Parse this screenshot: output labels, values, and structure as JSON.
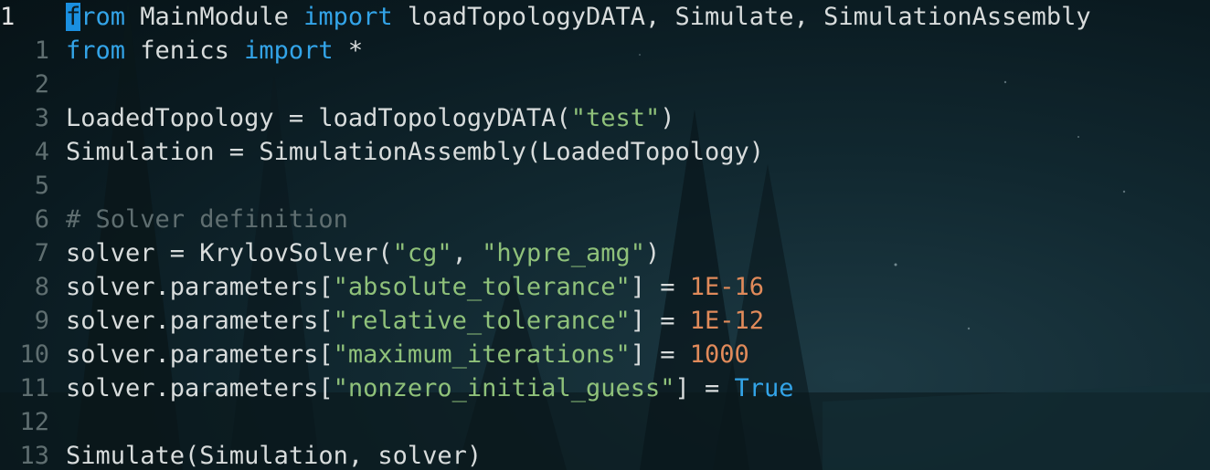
{
  "editor": {
    "lines": [
      {
        "number": "1",
        "tokens": [
          {
            "t": "f",
            "c": "kw cursor"
          },
          {
            "t": "rom",
            "c": "kw"
          },
          {
            "t": " MainModule ",
            "c": ""
          },
          {
            "t": "import",
            "c": "kw"
          },
          {
            "t": " loadTopologyDATA, Simulate, SimulationAssembly",
            "c": ""
          }
        ]
      },
      {
        "number": "1",
        "tokens": [
          {
            "t": "from",
            "c": "kw"
          },
          {
            "t": " fenics ",
            "c": ""
          },
          {
            "t": "import",
            "c": "kw"
          },
          {
            "t": " *",
            "c": ""
          }
        ]
      },
      {
        "number": "2",
        "tokens": []
      },
      {
        "number": "3",
        "tokens": [
          {
            "t": "LoadedTopology = loadTopologyDATA(",
            "c": ""
          },
          {
            "t": "\"test\"",
            "c": "str"
          },
          {
            "t": ")",
            "c": ""
          }
        ]
      },
      {
        "number": "4",
        "tokens": [
          {
            "t": "Simulation = SimulationAssembly(LoadedTopology)",
            "c": ""
          }
        ]
      },
      {
        "number": "5",
        "tokens": []
      },
      {
        "number": "6",
        "tokens": [
          {
            "t": "# Solver definition",
            "c": "cmt"
          }
        ]
      },
      {
        "number": "7",
        "tokens": [
          {
            "t": "solver = KrylovSolver(",
            "c": ""
          },
          {
            "t": "\"cg\"",
            "c": "str"
          },
          {
            "t": ", ",
            "c": ""
          },
          {
            "t": "\"hypre_amg\"",
            "c": "str"
          },
          {
            "t": ")",
            "c": ""
          }
        ]
      },
      {
        "number": "8",
        "tokens": [
          {
            "t": "solver.parameters[",
            "c": ""
          },
          {
            "t": "\"absolute_tolerance\"",
            "c": "str"
          },
          {
            "t": "] = ",
            "c": ""
          },
          {
            "t": "1E-16",
            "c": "num"
          }
        ]
      },
      {
        "number": "9",
        "tokens": [
          {
            "t": "solver.parameters[",
            "c": ""
          },
          {
            "t": "\"relative_tolerance\"",
            "c": "str"
          },
          {
            "t": "] = ",
            "c": ""
          },
          {
            "t": "1E-12",
            "c": "num"
          }
        ]
      },
      {
        "number": "10",
        "tokens": [
          {
            "t": "solver.parameters[",
            "c": ""
          },
          {
            "t": "\"maximum_iterations\"",
            "c": "str"
          },
          {
            "t": "] = ",
            "c": ""
          },
          {
            "t": "1000",
            "c": "num"
          }
        ]
      },
      {
        "number": "11",
        "tokens": [
          {
            "t": "solver.parameters[",
            "c": ""
          },
          {
            "t": "\"nonzero_initial_guess\"",
            "c": "str"
          },
          {
            "t": "] = ",
            "c": ""
          },
          {
            "t": "True",
            "c": "bool"
          }
        ]
      },
      {
        "number": "12",
        "tokens": []
      },
      {
        "number": "13",
        "tokens": [
          {
            "t": "Simulate(Simulation, solver)",
            "c": ""
          }
        ]
      }
    ]
  },
  "colors": {
    "keyword": "#33a4e8",
    "string": "#8fc17a",
    "number": "#e08a5a",
    "comment": "#5f6e70",
    "cursor": "#1a8fe0"
  }
}
